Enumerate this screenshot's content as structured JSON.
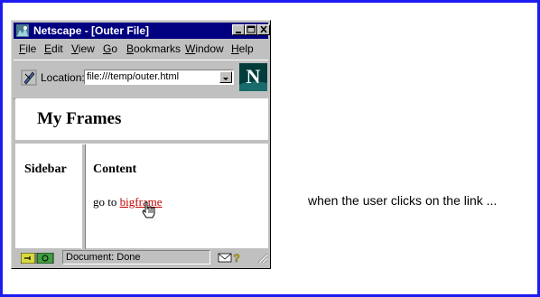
{
  "window": {
    "title": "Netscape - [Outer File]",
    "menu": [
      "File",
      "Edit",
      "View",
      "Go",
      "Bookmarks",
      "Window",
      "Help"
    ]
  },
  "location_bar": {
    "label": "Location:",
    "url": "file:///temp/outer.html"
  },
  "frames": {
    "top": {
      "title": "My Frames"
    },
    "sidebar": {
      "heading": "Sidebar"
    },
    "content": {
      "heading": "Content",
      "prefix": "go to ",
      "link_text": "bigframe"
    }
  },
  "status_bar": {
    "text": "Document: Done"
  },
  "caption": "when the user clicks on the link ...",
  "colors": {
    "slide_border": "#1c1cf0",
    "titlebar": "#000080",
    "link": "#c00000",
    "chrome": "#c0c0c0"
  }
}
